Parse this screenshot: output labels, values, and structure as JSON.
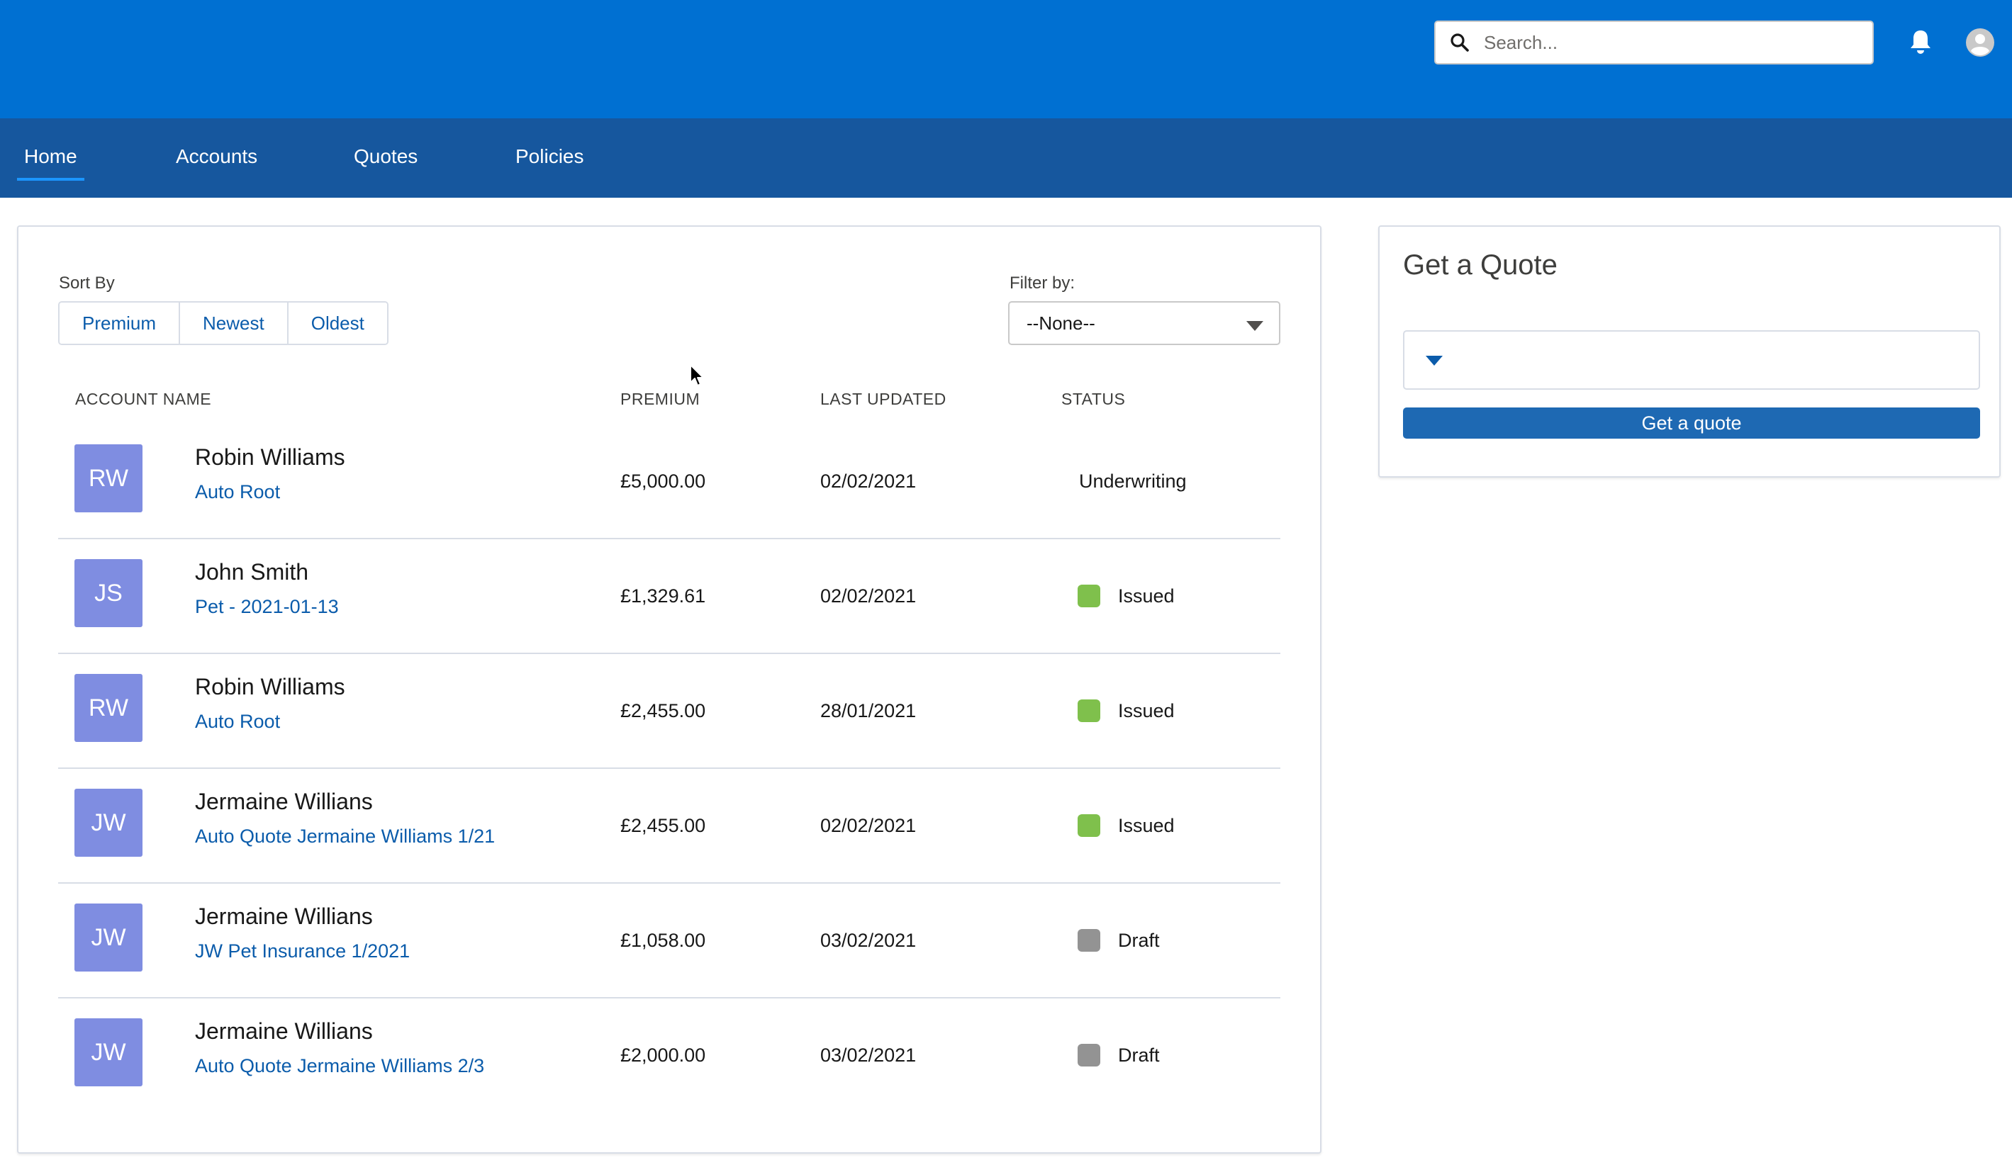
{
  "header": {
    "search": {
      "placeholder": "Search..."
    },
    "icons": {
      "search": "search-icon",
      "notifications": "bell-icon",
      "user": "user-avatar-icon"
    },
    "brand_color": "#0070d2"
  },
  "nav": {
    "items": [
      {
        "label": "Home",
        "active": true
      },
      {
        "label": "Accounts",
        "active": false
      },
      {
        "label": "Quotes",
        "active": false
      },
      {
        "label": "Policies",
        "active": false
      }
    ]
  },
  "list": {
    "sort_label": "Sort By",
    "sort_options": [
      "Premium",
      "Newest",
      "Oldest"
    ],
    "filter_label": "Filter by:",
    "filter_value": "--None--",
    "columns": [
      "ACCOUNT NAME",
      "PREMIUM",
      "LAST UPDATED",
      "STATUS"
    ],
    "rows": [
      {
        "initials": "RW",
        "name": "Robin Williams",
        "item": "Auto Root",
        "premium": "£5,000.00",
        "updated": "02/02/2021",
        "status": "Underwriting",
        "status_color": ""
      },
      {
        "initials": "JS",
        "name": "John Smith",
        "item": "Pet - 2021-01-13",
        "premium": "£1,329.61",
        "updated": "02/02/2021",
        "status": "Issued",
        "status_color": "#7fc04c"
      },
      {
        "initials": "RW",
        "name": "Robin Williams",
        "item": "Auto Root",
        "premium": "£2,455.00",
        "updated": "28/01/2021",
        "status": "Issued",
        "status_color": "#7fc04c"
      },
      {
        "initials": "JW",
        "name": "Jermaine Willians",
        "item": "Auto Quote Jermaine Williams 1/21",
        "premium": "£2,455.00",
        "updated": "02/02/2021",
        "status": "Issued",
        "status_color": "#7fc04c"
      },
      {
        "initials": "JW",
        "name": "Jermaine Willians",
        "item": "JW Pet Insurance 1/2021",
        "premium": "£1,058.00",
        "updated": "03/02/2021",
        "status": "Draft",
        "status_color": "#939393"
      },
      {
        "initials": "JW",
        "name": "Jermaine Willians",
        "item": "Auto Quote Jermaine Williams 2/3",
        "premium": "£2,000.00",
        "updated": "03/02/2021",
        "status": "Draft",
        "status_color": "#939393"
      }
    ]
  },
  "quote": {
    "title": "Get a Quote",
    "select_value": "",
    "button_label": "Get a quote"
  }
}
